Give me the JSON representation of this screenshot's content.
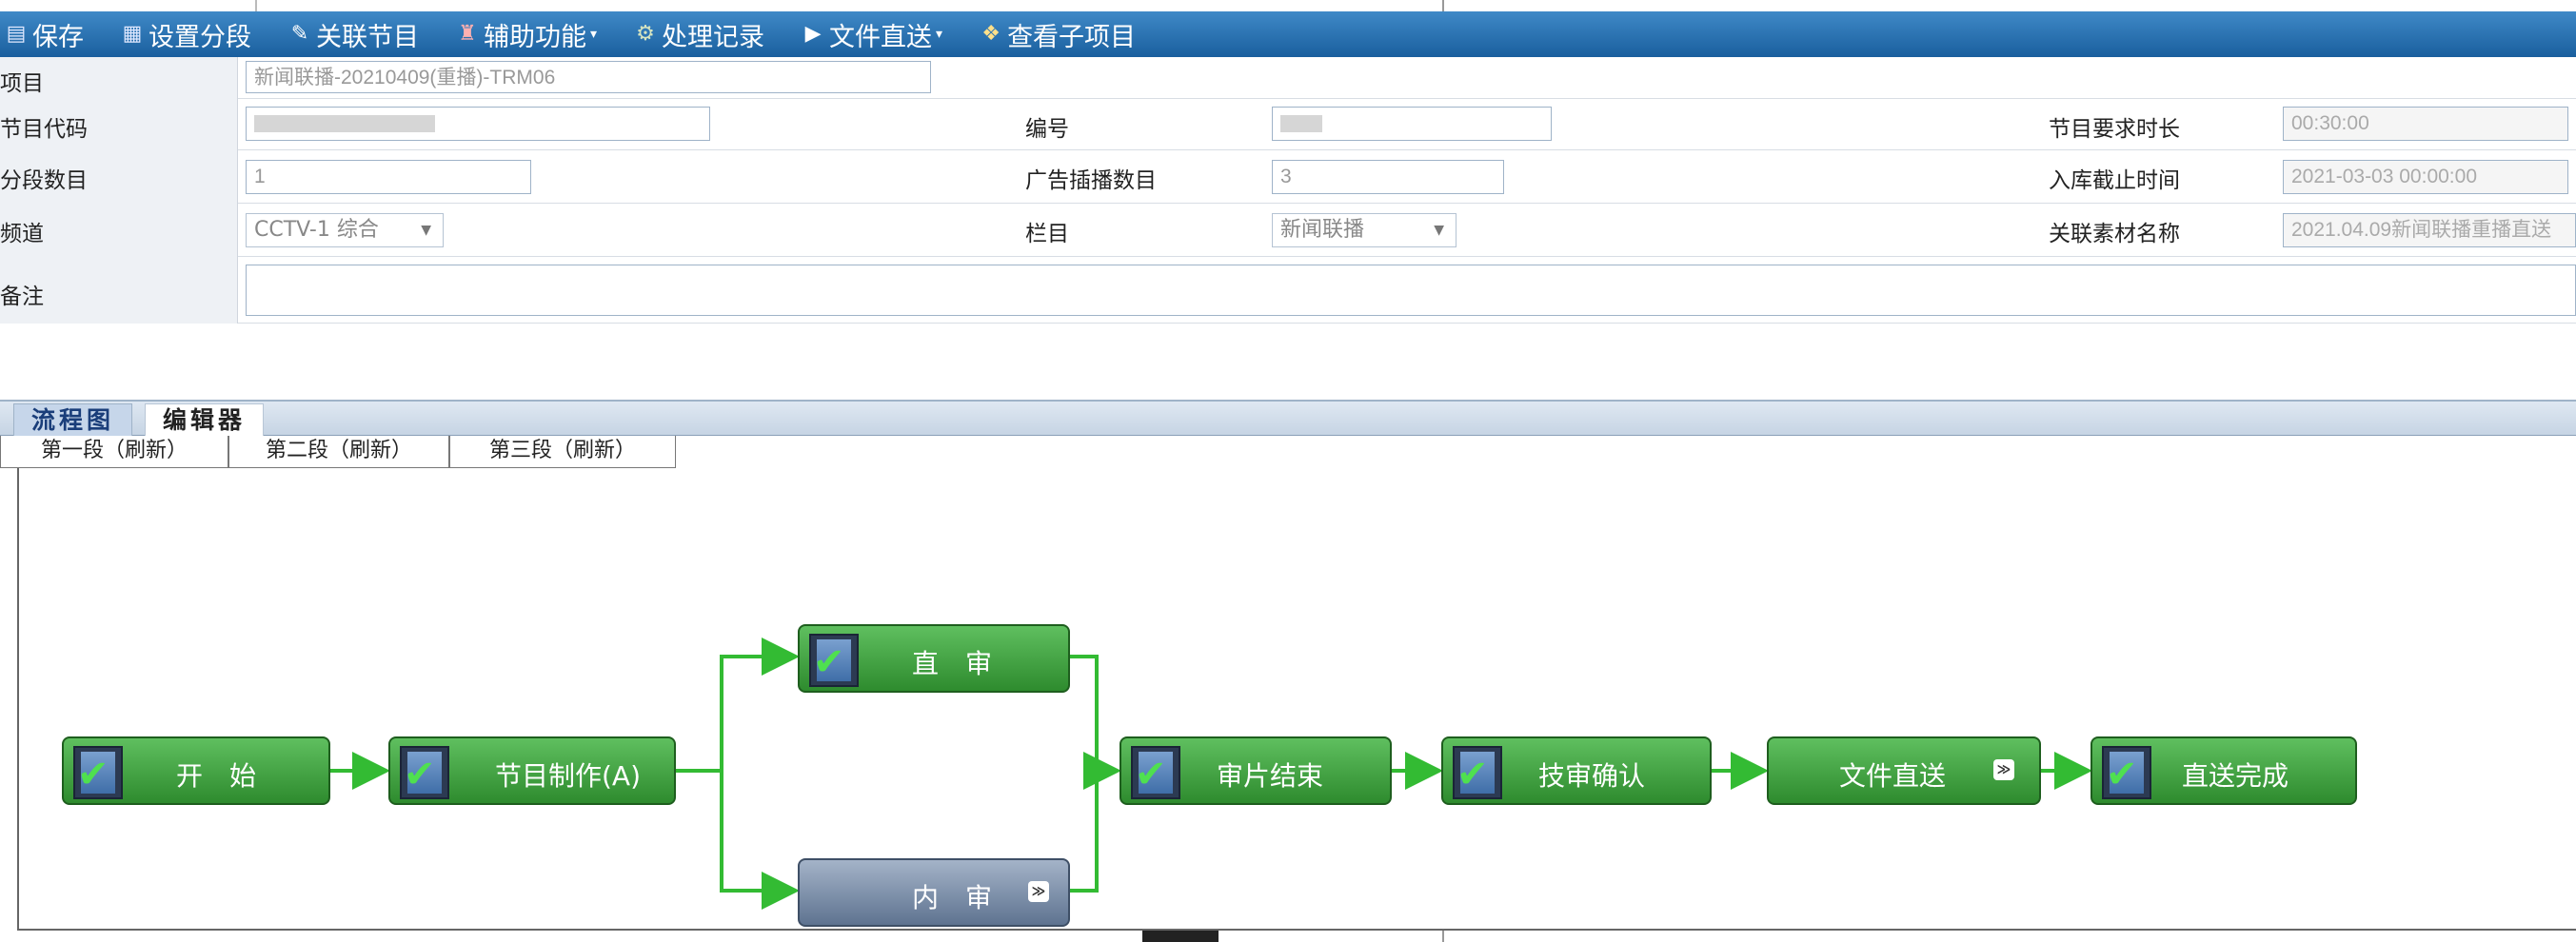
{
  "toolbar": {
    "save": "保存",
    "segment": "设置分段",
    "link": "关联节目",
    "assist": "辅助功能",
    "record": "处理记录",
    "direct": "文件直送",
    "children": "查看子项目"
  },
  "form": {
    "project_label": "项目",
    "project_value": "新闻联播-20210409(重播)-TRM06",
    "code_label": "节目代码",
    "number_label": "编号",
    "duration_label": "节目要求时长",
    "duration_value": "00:30:00",
    "segments_label": "分段数目",
    "segments_value": "1",
    "ads_label": "广告插播数目",
    "ads_value": "3",
    "deadline_label": "入库截止时间",
    "deadline_value": "2021-03-03 00:00:00",
    "channel_label": "频道",
    "channel_value": "CCTV-1 综合",
    "column_label": "栏目",
    "column_value": "新闻联播",
    "material_label": "关联素材名称",
    "material_value": "2021.04.09新闻联播重播直送",
    "note_label": "备注"
  },
  "tabs": {
    "flow": "流程图",
    "editor": "编辑器"
  },
  "subtabs": [
    "第一段（刷新）",
    "第二段（刷新）",
    "第三段（刷新）"
  ],
  "flow": {
    "start": "开　始",
    "production": "节目制作(A)",
    "direct_review": "直　审",
    "internal_review": "内　审",
    "review_end": "审片结束",
    "tech_confirm": "技审确认",
    "file_direct": "文件直送",
    "direct_done": "直送完成"
  },
  "colors": {
    "toolbar": "#1a5f9e",
    "node_green": "#2e8b2e",
    "node_blue": "#5e7390",
    "edge": "#33bb33"
  }
}
